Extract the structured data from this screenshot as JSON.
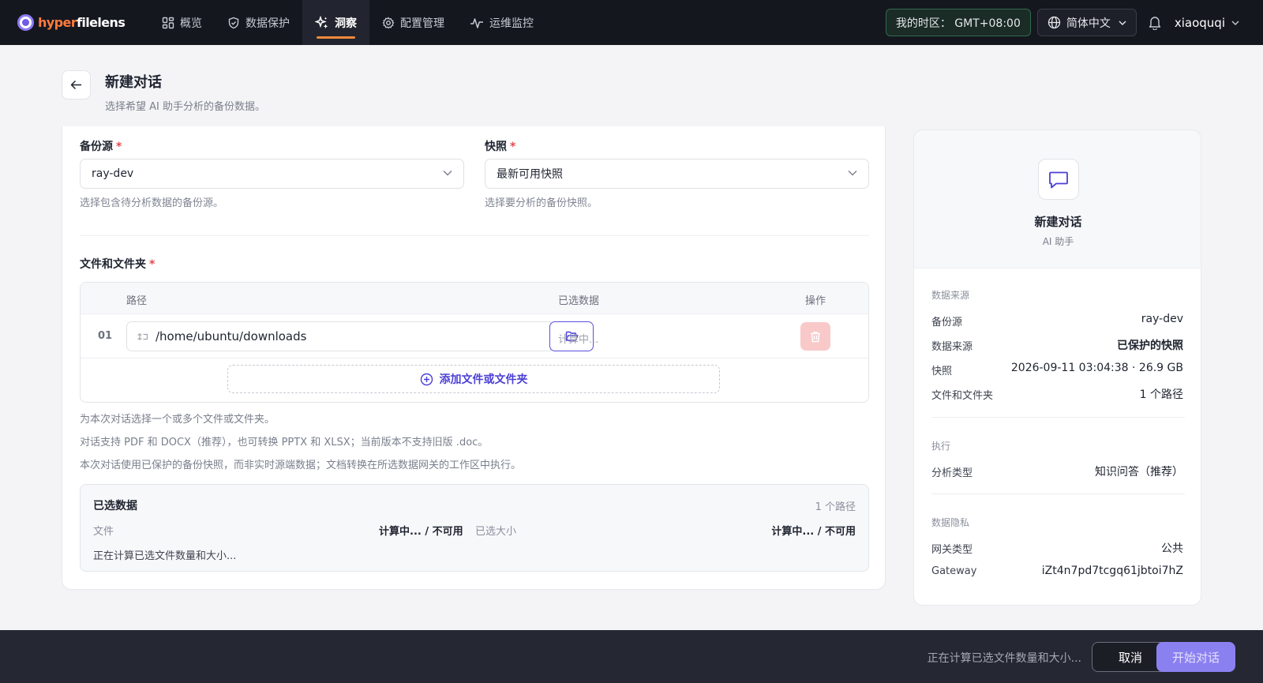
{
  "app": {
    "logo_part1": "hyper",
    "logo_part2": "filelens"
  },
  "nav": {
    "items": [
      {
        "label": "概览",
        "icon": "grid-icon"
      },
      {
        "label": "数据保护",
        "icon": "shield-icon"
      },
      {
        "label": "洞察",
        "icon": "sparkle-icon",
        "active": true
      },
      {
        "label": "配置管理",
        "icon": "gear-icon"
      },
      {
        "label": "运维监控",
        "icon": "pulse-icon"
      }
    ]
  },
  "topbar": {
    "timezone": "我的时区： GMT+08:00",
    "language": "简体中文",
    "username": "xiaoquqi"
  },
  "page": {
    "title": "新建对话",
    "subtitle": "选择希望 AI 助手分析的备份数据。"
  },
  "form": {
    "backup_source": {
      "label": "备份源",
      "required_mark": "*",
      "value": "ray-dev",
      "hint": "选择包含待分析数据的备份源。"
    },
    "snapshot": {
      "label": "快照",
      "required_mark": "*",
      "value": "最新可用快照",
      "hint": "选择要分析的备份快照。"
    },
    "files": {
      "label": "文件和文件夹",
      "required_mark": "*",
      "columns": {
        "path": "路径",
        "selected": "已选数据",
        "actions": "操作"
      },
      "rows": [
        {
          "num": "01",
          "path": "/home/ubuntu/downloads",
          "selected": "计算中..."
        }
      ],
      "add_label": "添加文件或文件夹"
    },
    "notes": [
      "为本次对话选择一个或多个文件或文件夹。",
      "对话支持 PDF 和 DOCX（推荐），也可转换 PPTX 和 XLSX；当前版本不支持旧版 .doc。",
      "本次对话使用已保护的备份快照，而非实时源端数据；文档转换在所选数据网关的工作区中执行。"
    ],
    "selected_summary": {
      "title": "已选数据",
      "count": "1 个路径",
      "files_label": "文件",
      "files_value": "计算中... / 不可用",
      "size_label": "已选大小",
      "size_value": "计算中... / 不可用",
      "status": "正在计算已选文件数量和大小..."
    }
  },
  "side": {
    "title": "新建对话",
    "subtitle": "AI 助手",
    "sections": {
      "source": {
        "title": "数据来源",
        "rows": [
          {
            "k": "备份源",
            "v": "ray-dev"
          },
          {
            "k": "数据来源",
            "v": "已保护的快照"
          },
          {
            "k": "快照",
            "v": "2026-09-11 03:04:38 · 26.9 GB"
          },
          {
            "k": "文件和文件夹",
            "v": "1 个路径"
          }
        ]
      },
      "exec": {
        "title": "执行",
        "rows": [
          {
            "k": "分析类型",
            "v": "知识问答（推荐）"
          }
        ]
      },
      "privacy": {
        "title": "数据隐私",
        "rows": [
          {
            "k": "网关类型",
            "v": "公共"
          },
          {
            "k": "Gateway",
            "v": "iZt4n7pd7tcgq61jbtoi7hZ"
          }
        ]
      }
    }
  },
  "bottombar": {
    "status": "正在计算已选文件数量和大小...",
    "cancel_label": "取消",
    "start_label": "开始对话"
  },
  "colors": {
    "accent": "#5b4fe0",
    "nav_active_underline": "#f08a3c",
    "danger_soft": "#f9c9c9",
    "start_button": "#8b80f0"
  }
}
